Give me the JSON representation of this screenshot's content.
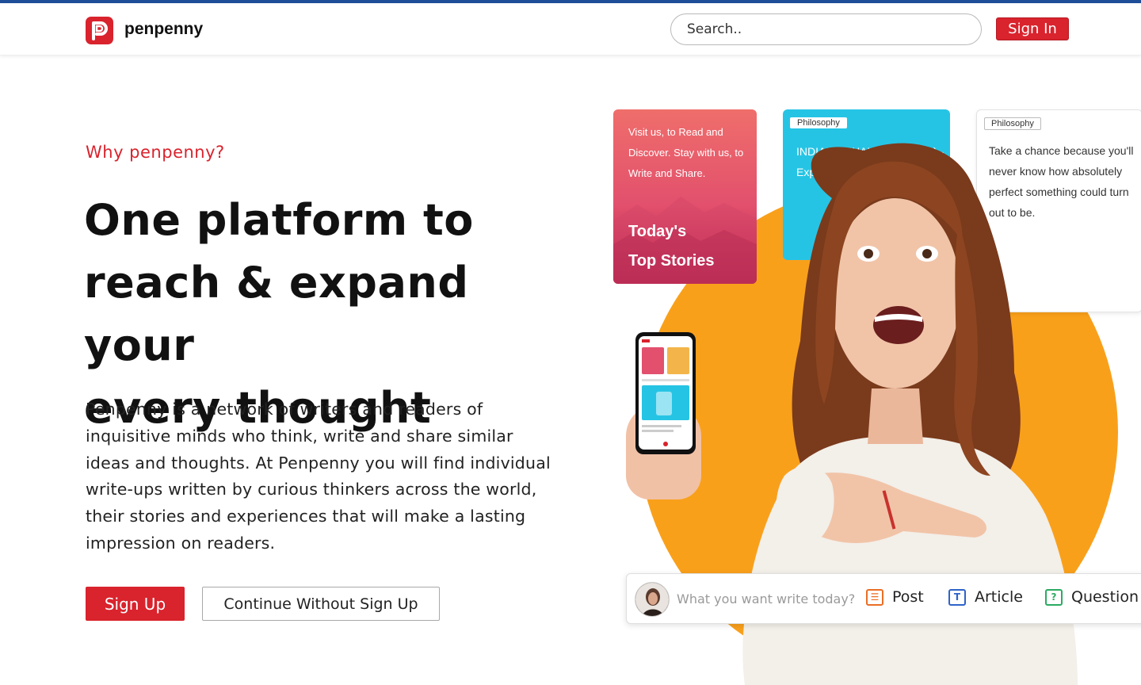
{
  "colors": {
    "brand_red": "#d9232d",
    "accent_orange": "#f9a01b",
    "top_line": "#1f4e99"
  },
  "header": {
    "logo_icon": "penpenny-logo-icon",
    "brand": "penpenny",
    "search_placeholder": "Search..",
    "signin_label": "Sign In"
  },
  "hero": {
    "eyebrow": "Why penpenny?",
    "headline_lines": [
      "One platform to",
      "reach & expand your",
      "every thought"
    ],
    "description": "Penpenny is a network of writers and readers of inquisitive minds who think, write and share similar ideas and thoughts. At Penpenny you will find individual write-ups written by curious thinkers across the world, their stories and experiences that will make a lasting impression on readers.",
    "signup_label": "Sign Up",
    "continue_label": "Continue Without Sign Up"
  },
  "cards": {
    "red": {
      "text": "Visit us, to Read and Discover. Stay with us, to Write and Share.",
      "title_line1": "Today's",
      "title_line2": "Top Stories"
    },
    "blue": {
      "tag": "Philosophy",
      "text": "INDIAN PENAL CODE (IPC) - Explained Form."
    },
    "white": {
      "tag": "Philosophy",
      "text": "Take a chance because you'll never know how absolutely perfect something could turn out to be."
    }
  },
  "composer": {
    "placeholder": "What you want write today?",
    "options": [
      {
        "icon": "post-icon",
        "label": "Post"
      },
      {
        "icon": "article-icon",
        "label": "Article"
      },
      {
        "icon": "question-icon",
        "label": "Question"
      }
    ]
  }
}
